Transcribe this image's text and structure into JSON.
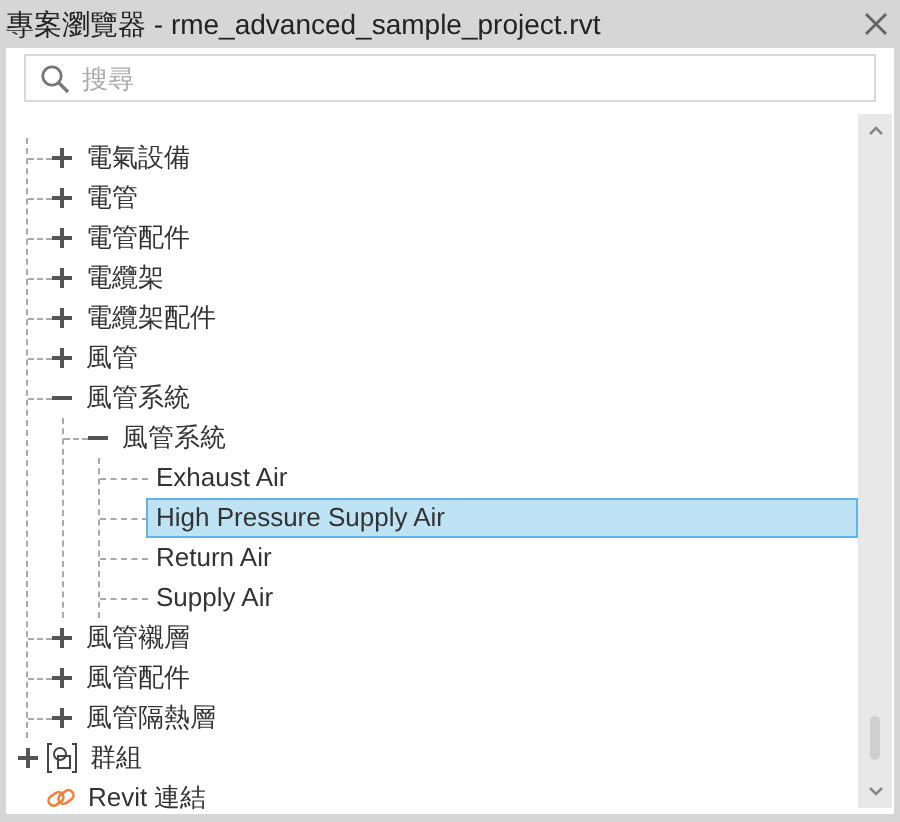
{
  "window": {
    "title": "專案瀏覽器 - rme_advanced_sample_project.rvt"
  },
  "search": {
    "placeholder": "搜尋"
  },
  "tree": {
    "scrolled_branch": [
      {
        "label": "電氣設備",
        "expanded": false,
        "selected": false
      },
      {
        "label": "電管",
        "expanded": false,
        "selected": false
      },
      {
        "label": "電管配件",
        "expanded": false,
        "selected": false
      },
      {
        "label": "電纜架",
        "expanded": false,
        "selected": false
      },
      {
        "label": "電纜架配件",
        "expanded": false,
        "selected": false
      },
      {
        "label": "風管",
        "expanded": false,
        "selected": false
      },
      {
        "label": "風管系統",
        "expanded": true,
        "selected": false,
        "children": [
          {
            "label": "風管系統",
            "expanded": true,
            "selected": false,
            "children": [
              {
                "label": "Exhaust Air",
                "selected": false
              },
              {
                "label": "High Pressure Supply Air",
                "selected": true
              },
              {
                "label": "Return Air",
                "selected": false
              },
              {
                "label": "Supply Air",
                "selected": false
              }
            ]
          }
        ]
      },
      {
        "label": "風管襯層",
        "expanded": false,
        "selected": false
      },
      {
        "label": "風管配件",
        "expanded": false,
        "selected": false
      },
      {
        "label": "風管隔熱層",
        "expanded": false,
        "selected": false
      }
    ],
    "root_items": [
      {
        "kind": "group",
        "label": "群組",
        "expanded": false,
        "selected": false
      },
      {
        "kind": "link",
        "label": "Revit 連結",
        "selected": false
      }
    ]
  }
}
